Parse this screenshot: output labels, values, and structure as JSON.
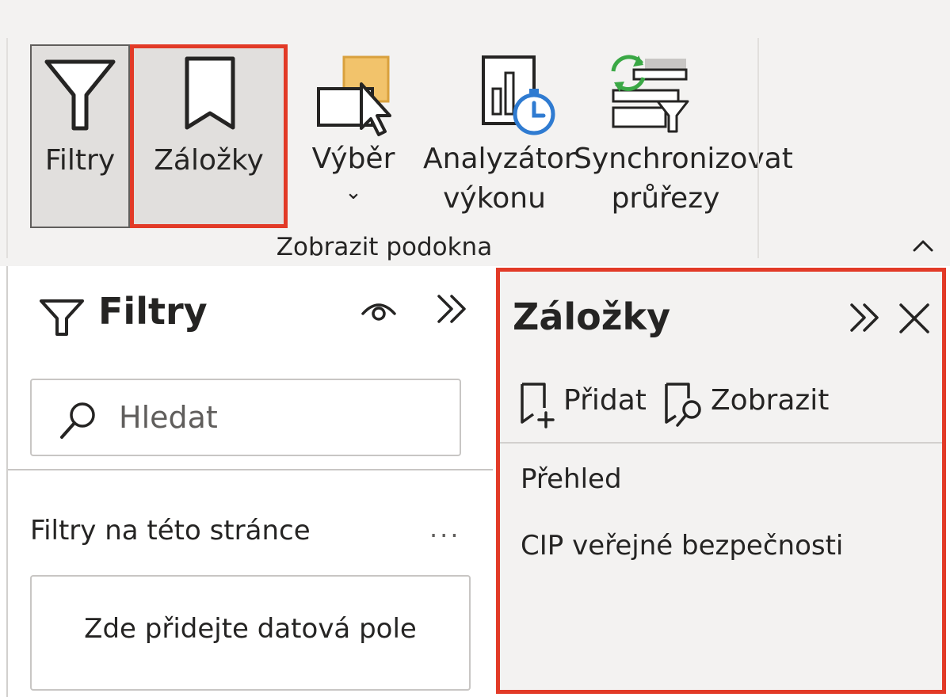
{
  "ribbon": {
    "buttons": [
      {
        "label": "Filtry",
        "icon": "funnel-icon",
        "selected": true
      },
      {
        "label": "Záložky",
        "icon": "bookmark-icon",
        "selected": true,
        "highlighted": true
      },
      {
        "label": "Výběr",
        "icon": "selection-pane-icon",
        "has_dropdown": true
      },
      {
        "label_line1": "Analyzátor",
        "label_line2": "výkonu",
        "icon": "performance-analyzer-icon"
      },
      {
        "label_line1": "Synchronizovat",
        "label_line2": "průřezy",
        "icon": "sync-slicers-icon"
      }
    ],
    "group_label": "Zobrazit podokna",
    "dropdown_glyph": "⌄",
    "collapse_icon": "chevron-up-icon"
  },
  "filters_pane": {
    "title": "Filtry",
    "search_placeholder": "Hledat",
    "search_value": "",
    "section_label": "Filtry na této stránce",
    "more_label": "...",
    "dropzone_text": "Zde přidejte datová pole"
  },
  "bookmarks_pane": {
    "title": "Záložky",
    "add_label": "Přidat",
    "view_label": "Zobrazit",
    "items": [
      "Přehled",
      "CIP veřejné bezpečnosti"
    ]
  },
  "colors": {
    "highlight": "#e23a27",
    "ribbon_bg": "#f3f2f1",
    "selected_bg": "#e1dfdd",
    "sync_green": "#3aa845",
    "analyzer_blue": "#2f7bd1",
    "selection_orange": "#f2c36b"
  }
}
